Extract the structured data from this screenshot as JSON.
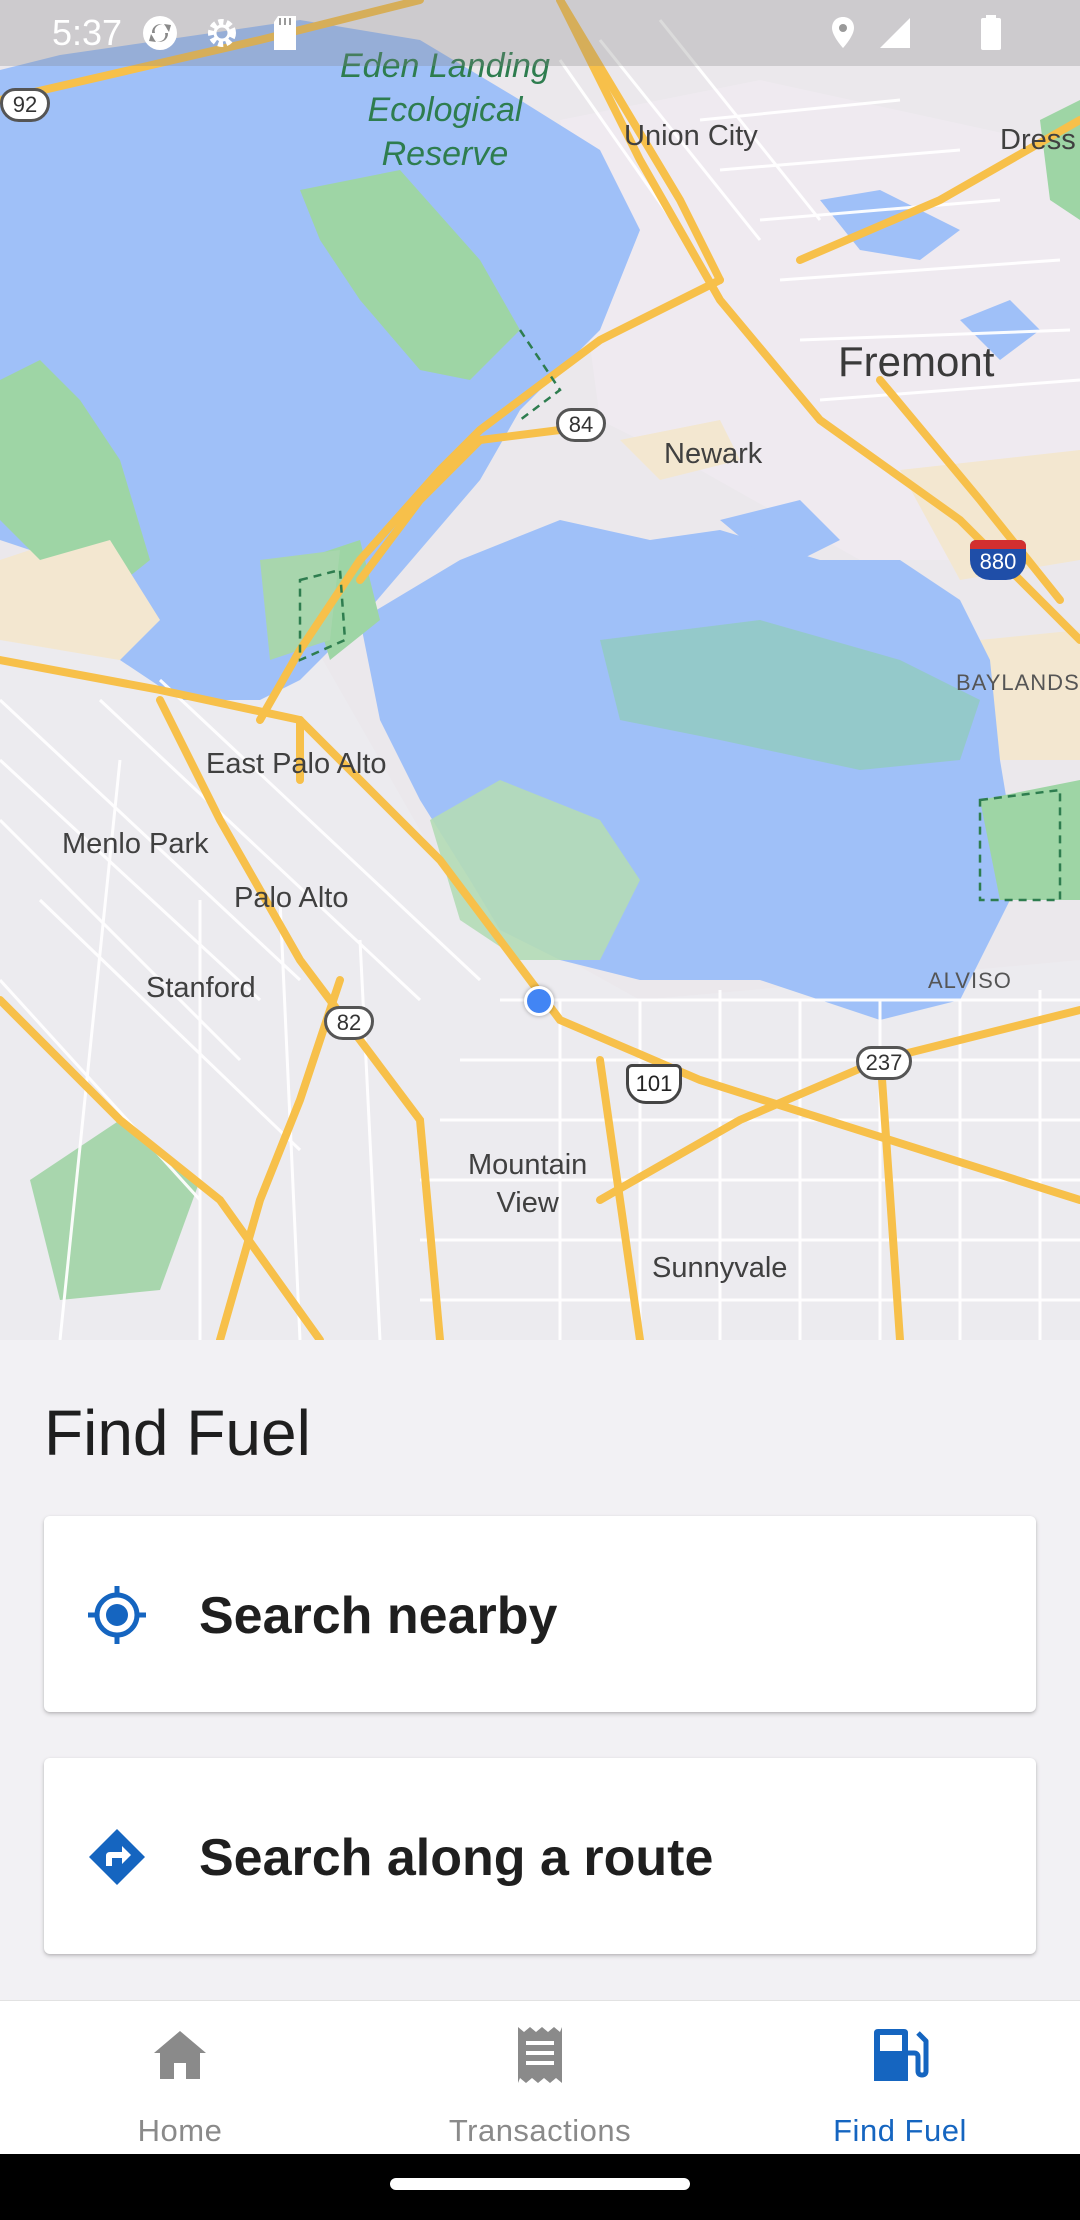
{
  "status_bar": {
    "time": "5:37",
    "left_icons": [
      "sync-icon",
      "settings-gear-icon",
      "sd-card-icon"
    ],
    "right_icons": [
      "location-icon",
      "cell-signal-icon",
      "battery-icon"
    ]
  },
  "map": {
    "labels": {
      "eden_landing": "Eden Landing Ecological Reserve",
      "eden_line1": "Eden Landing",
      "eden_line2": "Ecological",
      "eden_line3": "Reserve",
      "union_city": "Union City",
      "dress": "Dress",
      "fremont": "Fremont",
      "newark": "Newark",
      "baylands": "BAYLANDS",
      "east_palo_alto": "East Palo Alto",
      "menlo_park": "Menlo Park",
      "palo_alto": "Palo Alto",
      "stanford": "Stanford",
      "alviso": "ALVISO",
      "mountain_view_line1": "Mountain",
      "mountain_view_line2": "View",
      "sunnyvale": "Sunnyvale"
    },
    "shields": {
      "r92": "92",
      "r84": "84",
      "i880": "880",
      "r82": "82",
      "us101": "101",
      "r237": "237"
    },
    "colors": {
      "water": "#9fc0f8",
      "land": "#ebe8ec",
      "park": "#9ed5a5",
      "highway": "#f7c04a",
      "urban": "#f3e7d0"
    }
  },
  "find_fuel": {
    "title": "Find Fuel",
    "search_nearby_label": "Search nearby",
    "search_route_label": "Search along a route",
    "accent_color": "#1565c0"
  },
  "bottom_nav": {
    "items": [
      {
        "label": "Home",
        "icon": "home-icon",
        "active": false
      },
      {
        "label": "Transactions",
        "icon": "receipt-icon",
        "active": false
      },
      {
        "label": "Find Fuel",
        "icon": "gas-station-icon",
        "active": true
      }
    ]
  }
}
